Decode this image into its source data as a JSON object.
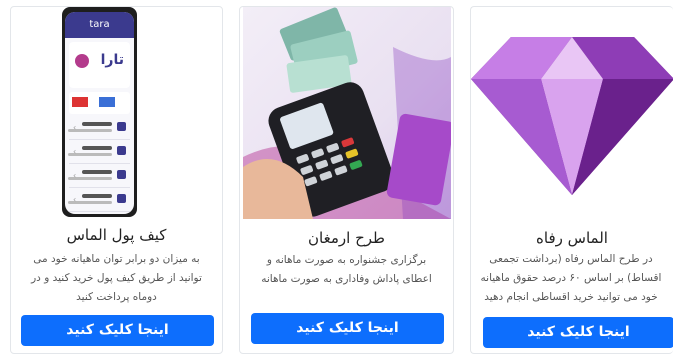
{
  "cards": [
    {
      "title": "کیف پول الماس",
      "description": "به میزان دو برابر توان ماهیانه خود می توانید از طریق کیف پول خرید کنید و در دوماه پرداخت کنید",
      "button_label": "اینجا کلیک کنید"
    },
    {
      "title": "طرح ارمغان",
      "description": "برگزاری جشنواره به صورت ماهانه و اعطای پاداش وفاداری به صورت ماهانه",
      "button_label": "اینجا کلیک کنید"
    },
    {
      "title": "الماس رفاه",
      "description": "در طرح الماس رفاه (برداشت تجمعی اقساط) بر اساس ۶۰ درصد حقوق ماهیانه خود می توانید خرید اقساطی انجام دهید",
      "button_label": "اینجا کلیک کنید"
    }
  ],
  "phone": {
    "brand_text": "tara",
    "banner_logo": "تارا"
  },
  "colors": {
    "button": "#0d6efd",
    "diamond_light": "#c97de0",
    "diamond_dark": "#7b2a9e",
    "pos_bg": "#e9e4f0"
  }
}
